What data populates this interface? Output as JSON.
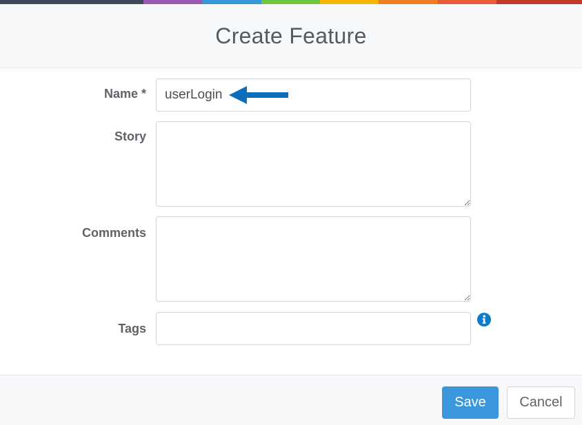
{
  "header": {
    "title": "Create Feature",
    "color_bar": [
      "#3a4a5a",
      "#9b59b6",
      "#3498db",
      "#6cc644",
      "#f5b800",
      "#ef7d22",
      "#e85c3a",
      "#c0392b"
    ]
  },
  "form": {
    "name": {
      "label": "Name *",
      "value": "userLogin"
    },
    "story": {
      "label": "Story",
      "value": ""
    },
    "comments": {
      "label": "Comments",
      "value": ""
    },
    "tags": {
      "label": "Tags",
      "value": ""
    }
  },
  "annotation": {
    "arrow_color": "#0a6ebd",
    "icon": "left-arrow-icon"
  },
  "icons": {
    "tags_info": "info-icon"
  },
  "footer": {
    "save_label": "Save",
    "cancel_label": "Cancel"
  },
  "colors": {
    "accent": "#3a97dc",
    "info": "#0a7cc9"
  }
}
